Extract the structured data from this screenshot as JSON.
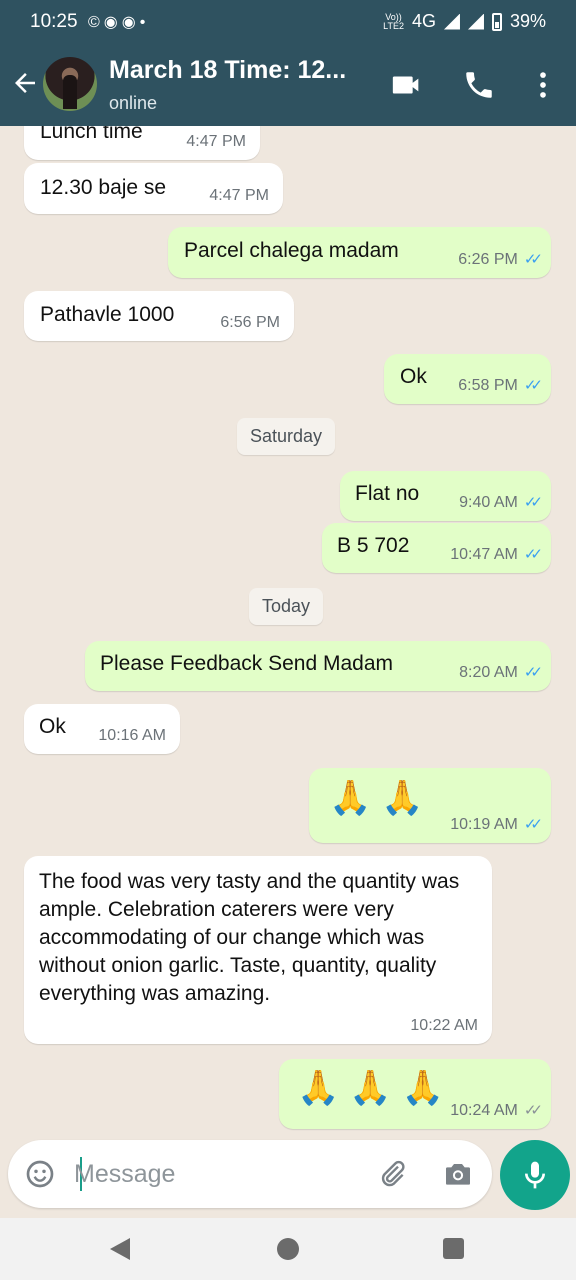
{
  "status_bar": {
    "time": "10:25",
    "icons": [
      "c-icon",
      "whatsapp-icon",
      "whatsapp-icon",
      "dot-icon"
    ],
    "network_type": "4G",
    "volte_line1": "Vo))",
    "volte_line2": "LTE2",
    "battery": "39%"
  },
  "header": {
    "title": "March 18 Time: 12...",
    "status": "online",
    "actions": [
      "video-call-icon",
      "phone-icon",
      "more-icon"
    ]
  },
  "messages": [
    {
      "dir": "in",
      "text": "Lunch time",
      "time": "4:47 PM"
    },
    {
      "dir": "in",
      "text": "12.30 baje se",
      "time": "4:47 PM"
    },
    {
      "dir": "out",
      "text": "Parcel chalega madam",
      "time": "6:26 PM",
      "read": true
    },
    {
      "dir": "in",
      "text": "Pathavle 1000",
      "time": "6:56 PM"
    },
    {
      "dir": "out",
      "text": "Ok",
      "time": "6:58 PM",
      "read": true
    },
    {
      "dir": "day",
      "text": "Saturday"
    },
    {
      "dir": "out",
      "text": "Flat no",
      "time": "9:40 AM",
      "read": true
    },
    {
      "dir": "out",
      "text": "B 5 702",
      "time": "10:47 AM",
      "read": true
    },
    {
      "dir": "day",
      "text": "Today"
    },
    {
      "dir": "out",
      "text": "Please Feedback Send Madam",
      "time": "8:20 AM",
      "read": true
    },
    {
      "dir": "in",
      "text": "Ok",
      "time": "10:16 AM"
    },
    {
      "dir": "out",
      "text": "🙏🙏",
      "time": "10:19 AM",
      "read": true
    },
    {
      "dir": "in",
      "text": "The food was very tasty and the quantity was ample. Celebration caterers were very accommodating of our change which was without onion garlic. Taste, quantity, quality everything was amazing.",
      "time": "10:22 AM"
    },
    {
      "dir": "out",
      "text": "🙏🙏🙏",
      "time": "10:24 AM",
      "read": false
    }
  ],
  "input": {
    "placeholder": "Message"
  },
  "colors": {
    "header": "#2f5260",
    "chat_background": "#efe7de",
    "incoming_bubble": "#ffffff",
    "outgoing_bubble": "#e2fec8",
    "read_ticks": "#3b9ff0",
    "mic_button": "#12a48b"
  }
}
